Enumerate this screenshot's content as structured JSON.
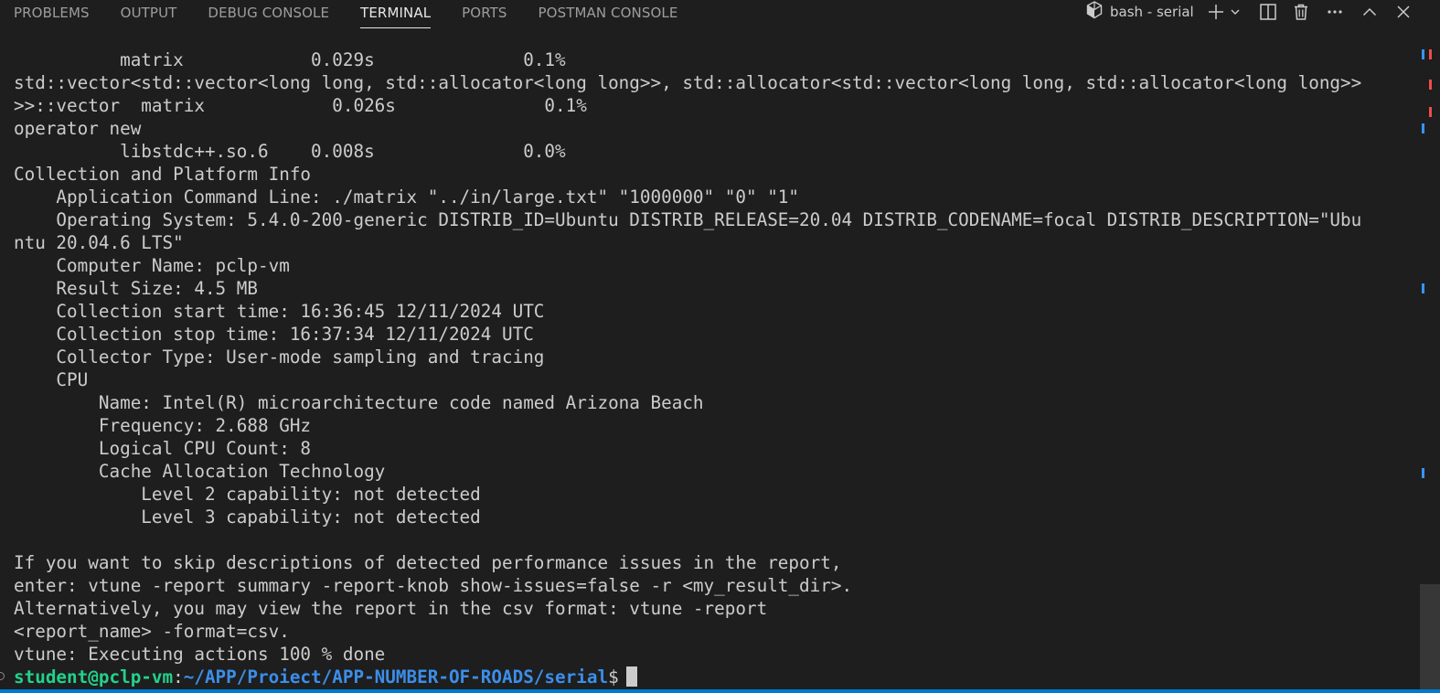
{
  "panel": {
    "tabs": [
      {
        "label": "PROBLEMS"
      },
      {
        "label": "OUTPUT"
      },
      {
        "label": "DEBUG CONSOLE"
      },
      {
        "label": "TERMINAL"
      },
      {
        "label": "PORTS"
      },
      {
        "label": "POSTMAN CONSOLE"
      }
    ],
    "active_tab": "TERMINAL",
    "terminal_instance": "bash - serial",
    "icons": {
      "terminal_instance": "terminal-icon",
      "new_terminal": "plus-icon",
      "launch_profile": "chevron-down-icon",
      "split": "split-terminal-icon",
      "kill": "trash-icon",
      "more": "more-actions-icon",
      "maximize": "chevron-up-icon",
      "close": "close-icon"
    }
  },
  "terminal": {
    "lines": [
      "          matrix            0.029s              0.1%",
      "std::vector<std::vector<long long, std::allocator<long long>>, std::allocator<std::vector<long long, std::allocator<long long>>",
      ">>::vector  matrix            0.026s              0.1%",
      "operator new",
      "          libstdc++.so.6    0.008s              0.0%",
      "Collection and Platform Info",
      "    Application Command Line: ./matrix \"../in/large.txt\" \"1000000\" \"0\" \"1\"",
      "    Operating System: 5.4.0-200-generic DISTRIB_ID=Ubuntu DISTRIB_RELEASE=20.04 DISTRIB_CODENAME=focal DISTRIB_DESCRIPTION=\"Ubu",
      "ntu 20.04.6 LTS\"",
      "    Computer Name: pclp-vm",
      "    Result Size: 4.5 MB",
      "    Collection start time: 16:36:45 12/11/2024 UTC",
      "    Collection stop time: 16:37:34 12/11/2024 UTC",
      "    Collector Type: User-mode sampling and tracing",
      "    CPU",
      "        Name: Intel(R) microarchitecture code named Arizona Beach",
      "        Frequency: 2.688 GHz",
      "        Logical CPU Count: 8",
      "        Cache Allocation Technology",
      "            Level 2 capability: not detected",
      "            Level 3 capability: not detected",
      "",
      "If you want to skip descriptions of detected performance issues in the report,",
      "enter: vtune -report summary -report-knob show-issues=false -r <my_result_dir>.",
      "Alternatively, you may view the report in the csv format: vtune -report",
      "<report_name> -format=csv.",
      "vtune: Executing actions 100 % done"
    ],
    "prompt": {
      "user_host": "student@pclp-vm",
      "colon": ":",
      "path": "~/APP/Proiect/APP-NUMBER-OF-ROADS/serial",
      "dollar": "$"
    }
  },
  "colors": {
    "background": "#1e1e1e",
    "text": "#cccccc",
    "prompt_user": "#23d18b",
    "prompt_path": "#3b8eea",
    "accent": "#007acc"
  }
}
